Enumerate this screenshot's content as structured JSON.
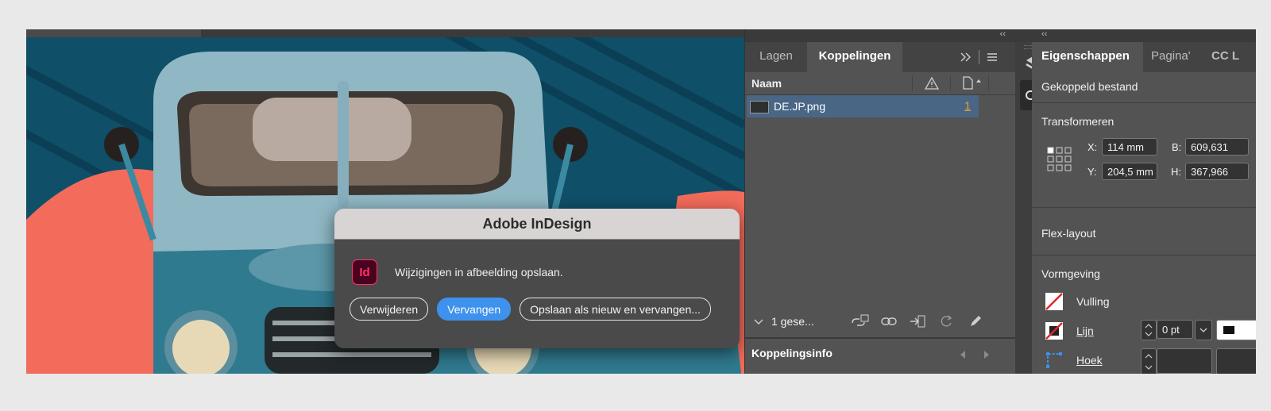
{
  "dialog": {
    "title": "Adobe InDesign",
    "app_icon_text": "Id",
    "message": "Wijzigingen in afbeelding opslaan.",
    "buttons": {
      "delete": "Verwijderen",
      "replace": "Vervangen",
      "save_new": "Opslaan als nieuw en vervangen..."
    }
  },
  "links_panel": {
    "collapse_glyph": "‹‹",
    "tabs": [
      "Lagen",
      "Koppelingen"
    ],
    "column_name": "Naam",
    "rows": [
      {
        "name": "DE.JP.png",
        "page": "1"
      }
    ],
    "footer_count": "1 gese...",
    "info_title": "Koppelingsinfo"
  },
  "properties_panel": {
    "collapse_glyph": "‹‹",
    "tabs": [
      "Eigenschappen",
      "Pagina'",
      "CC L"
    ],
    "linked_file": "Gekoppeld bestand",
    "transform": {
      "title": "Transformeren",
      "x_label": "X:",
      "x_value": "114 mm",
      "y_label": "Y:",
      "y_value": "204,5 mm",
      "w_label": "B:",
      "w_value": "609,631",
      "h_label": "H:",
      "h_value": "367,966"
    },
    "flex_layout": "Flex-layout",
    "appearance": {
      "title": "Vormgeving",
      "fill": "Vulling",
      "stroke": "Lijn",
      "stroke_value": "0 pt",
      "corner": "Hoek"
    }
  },
  "colors": {
    "accent": "#3e91ec",
    "selection": "#496685",
    "indesign": "#ff3366"
  }
}
